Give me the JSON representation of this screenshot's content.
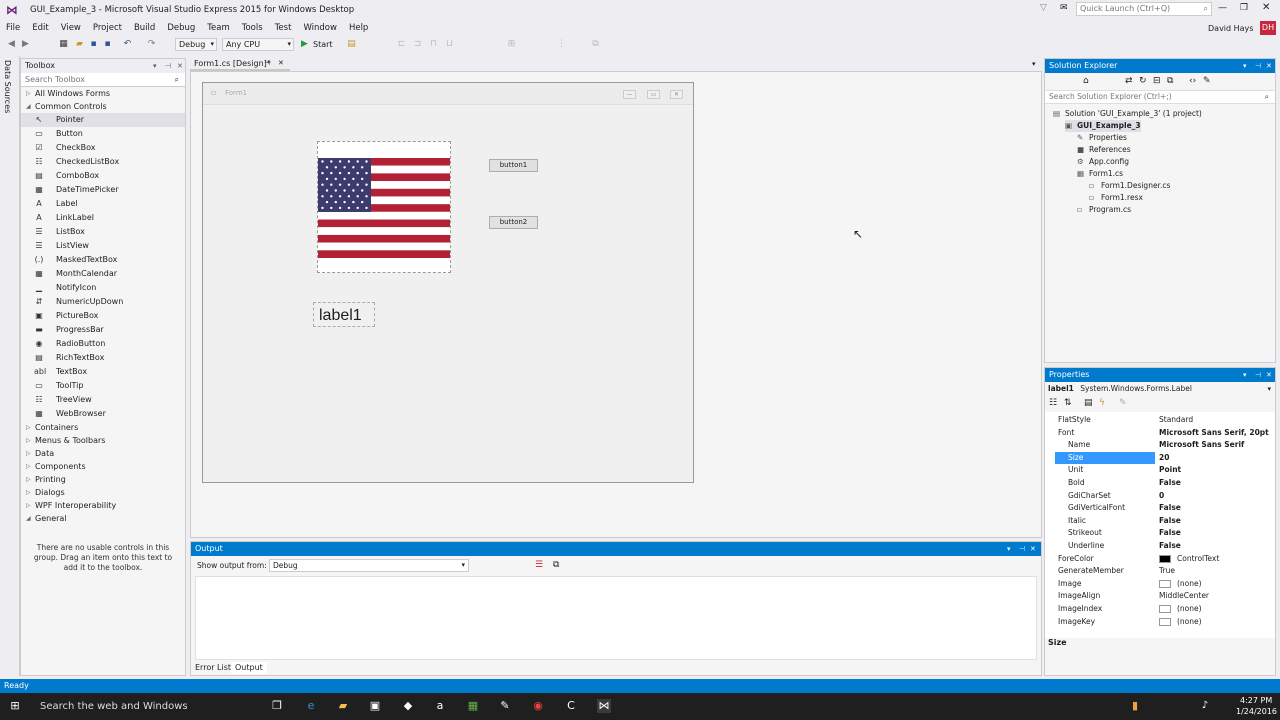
{
  "window": {
    "title": "GUI_Example_3 - Microsoft Visual Studio Express 2015 for Windows Desktop",
    "quick_launch_placeholder": "Quick Launch (Ctrl+Q)",
    "user_name": "David Hays",
    "user_initials": "DH"
  },
  "menu": [
    "File",
    "Edit",
    "View",
    "Project",
    "Build",
    "Debug",
    "Team",
    "Tools",
    "Test",
    "Window",
    "Help"
  ],
  "toolbar": {
    "config": "Debug",
    "platform": "Any CPU",
    "start_label": "Start"
  },
  "side_tab": "Data Sources",
  "toolbox": {
    "title": "Toolbox",
    "search_placeholder": "Search Toolbox",
    "all_forms": "All Windows Forms",
    "common_controls": "Common Controls",
    "items": [
      {
        "label": "Pointer",
        "icon": "↖"
      },
      {
        "label": "Button",
        "icon": "▭"
      },
      {
        "label": "CheckBox",
        "icon": "☑"
      },
      {
        "label": "CheckedListBox",
        "icon": "☷"
      },
      {
        "label": "ComboBox",
        "icon": "▤"
      },
      {
        "label": "DateTimePicker",
        "icon": "▦"
      },
      {
        "label": "Label",
        "icon": "A"
      },
      {
        "label": "LinkLabel",
        "icon": "A"
      },
      {
        "label": "ListBox",
        "icon": "☰"
      },
      {
        "label": "ListView",
        "icon": "☰"
      },
      {
        "label": "MaskedTextBox",
        "icon": "(.)"
      },
      {
        "label": "MonthCalendar",
        "icon": "▦"
      },
      {
        "label": "NotifyIcon",
        "icon": "▁"
      },
      {
        "label": "NumericUpDown",
        "icon": "⇵"
      },
      {
        "label": "PictureBox",
        "icon": "▣"
      },
      {
        "label": "ProgressBar",
        "icon": "▬"
      },
      {
        "label": "RadioButton",
        "icon": "◉"
      },
      {
        "label": "RichTextBox",
        "icon": "▤"
      },
      {
        "label": "TextBox",
        "icon": "abl"
      },
      {
        "label": "ToolTip",
        "icon": "▭"
      },
      {
        "label": "TreeView",
        "icon": "☷"
      },
      {
        "label": "WebBrowser",
        "icon": "▦"
      }
    ],
    "categories": [
      "Containers",
      "Menus & Toolbars",
      "Data",
      "Components",
      "Printing",
      "Dialogs",
      "WPF Interoperability"
    ],
    "general": "General",
    "note": "There are no usable controls in this group. Drag an item onto this text to add it to the toolbox."
  },
  "doc_tab": "Form1.cs [Design]*",
  "form": {
    "title": "Form1",
    "button1": "button1",
    "button2": "button2",
    "label1": "label1"
  },
  "output": {
    "title": "Output",
    "show_from_label": "Show output from:",
    "show_from_value": "Debug",
    "tabs": [
      "Error List",
      "Output"
    ]
  },
  "solution_explorer": {
    "title": "Solution Explorer",
    "search_placeholder": "Search Solution Explorer (Ctrl+;)",
    "items": [
      {
        "label": "Solution 'GUI_Example_3' (1 project)",
        "indent": 0,
        "bold": false
      },
      {
        "label": "GUI_Example_3",
        "indent": 1,
        "bold": true
      },
      {
        "label": "Properties",
        "indent": 2,
        "bold": false
      },
      {
        "label": "References",
        "indent": 2,
        "bold": false
      },
      {
        "label": "App.config",
        "indent": 2,
        "bold": false
      },
      {
        "label": "Form1.cs",
        "indent": 2,
        "bold": false
      },
      {
        "label": "Form1.Designer.cs",
        "indent": 3,
        "bold": false
      },
      {
        "label": "Form1.resx",
        "indent": 3,
        "bold": false
      },
      {
        "label": "Program.cs",
        "indent": 2,
        "bold": false
      }
    ]
  },
  "properties": {
    "title": "Properties",
    "object": "label1",
    "object_type": "System.Windows.Forms.Label",
    "rows": [
      {
        "name": "FlatStyle",
        "value": "Standard",
        "sub": false,
        "bold": false
      },
      {
        "name": "Font",
        "value": "Microsoft Sans Serif, 20pt",
        "sub": false,
        "bold": true
      },
      {
        "name": "Name",
        "value": "Microsoft Sans Serif",
        "sub": true,
        "bold": true
      },
      {
        "name": "Size",
        "value": "20",
        "sub": true,
        "bold": true,
        "selected": true
      },
      {
        "name": "Unit",
        "value": "Point",
        "sub": true,
        "bold": true
      },
      {
        "name": "Bold",
        "value": "False",
        "sub": true,
        "bold": true
      },
      {
        "name": "GdiCharSet",
        "value": "0",
        "sub": true,
        "bold": true
      },
      {
        "name": "GdiVerticalFont",
        "value": "False",
        "sub": true,
        "bold": true
      },
      {
        "name": "Italic",
        "value": "False",
        "sub": true,
        "bold": true
      },
      {
        "name": "Strikeout",
        "value": "False",
        "sub": true,
        "bold": true
      },
      {
        "name": "Underline",
        "value": "False",
        "sub": true,
        "bold": true
      },
      {
        "name": "ForeColor",
        "value": "ControlText",
        "sub": false,
        "bold": false
      },
      {
        "name": "GenerateMember",
        "value": "True",
        "sub": false,
        "bold": false
      },
      {
        "name": "Image",
        "value": "(none)",
        "sub": false,
        "bold": false
      },
      {
        "name": "ImageAlign",
        "value": "MiddleCenter",
        "sub": false,
        "bold": false
      },
      {
        "name": "ImageIndex",
        "value": "(none)",
        "sub": false,
        "bold": false
      },
      {
        "name": "ImageKey",
        "value": "(none)",
        "sub": false,
        "bold": false
      }
    ],
    "description_title": "Size"
  },
  "status": "Ready",
  "taskbar": {
    "search": "Search the web and Windows",
    "time": "4:27 PM",
    "date": "1/24/2016"
  },
  "colors": {
    "accent": "#007acc",
    "flag_red": "#b22234",
    "flag_blue": "#3c3b6e"
  }
}
